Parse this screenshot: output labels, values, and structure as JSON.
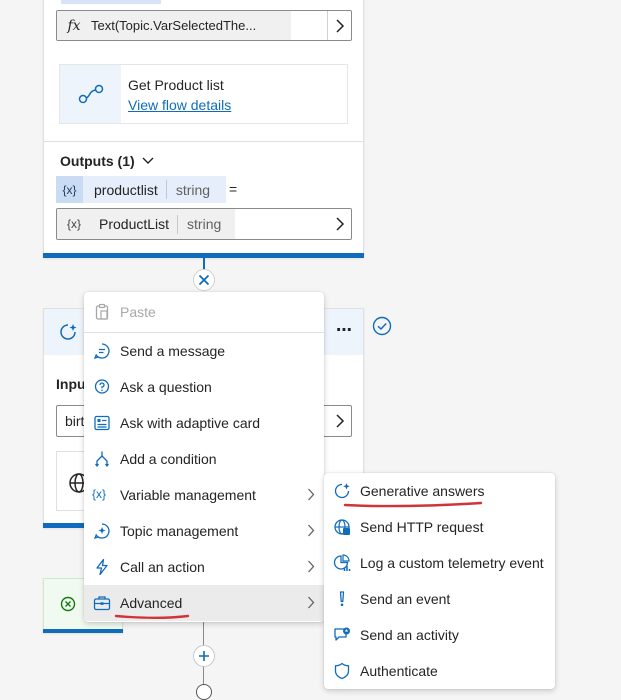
{
  "top_card": {
    "expression": "Text(Topic.VarSelectedThe...",
    "flow_title": "Get Product list",
    "flow_link": "View flow details",
    "outputs_label": "Outputs (1)",
    "output_var": "productlist",
    "output_type": "string",
    "equals": "=",
    "value_var": "ProductList",
    "value_type": "string",
    "fx": "fx"
  },
  "variable_glyph": "{x}",
  "hidden_card": {
    "input_label": "Inpu",
    "input_value": "birt"
  },
  "context_menu": {
    "items": [
      {
        "label": "Paste",
        "icon": "paste-icon",
        "disabled": true
      },
      {
        "label": "Send a message",
        "icon": "message-icon"
      },
      {
        "label": "Ask a question",
        "icon": "question-icon"
      },
      {
        "label": "Ask with adaptive card",
        "icon": "adaptive-card-icon"
      },
      {
        "label": "Add a condition",
        "icon": "condition-icon"
      },
      {
        "label": "Variable management",
        "icon": "variable-icon",
        "submenu": true
      },
      {
        "label": "Topic management",
        "icon": "topic-icon",
        "submenu": true
      },
      {
        "label": "Call an action",
        "icon": "action-icon",
        "submenu": true
      },
      {
        "label": "Advanced",
        "icon": "toolbox-icon",
        "submenu": true,
        "active": true
      }
    ]
  },
  "submenu": {
    "items": [
      {
        "label": "Generative answers",
        "icon": "generative-icon"
      },
      {
        "label": "Send HTTP request",
        "icon": "globe-icon"
      },
      {
        "label": "Log a custom telemetry event",
        "icon": "telemetry-icon"
      },
      {
        "label": "Send an event",
        "icon": "event-icon"
      },
      {
        "label": "Send an activity",
        "icon": "activity-icon"
      },
      {
        "label": "Authenticate",
        "icon": "shield-icon"
      }
    ]
  },
  "colors": {
    "accent": "#0f6cbd",
    "card_bar": "#0f6cbd",
    "annotation": "#d13438",
    "success": "#107c10"
  }
}
